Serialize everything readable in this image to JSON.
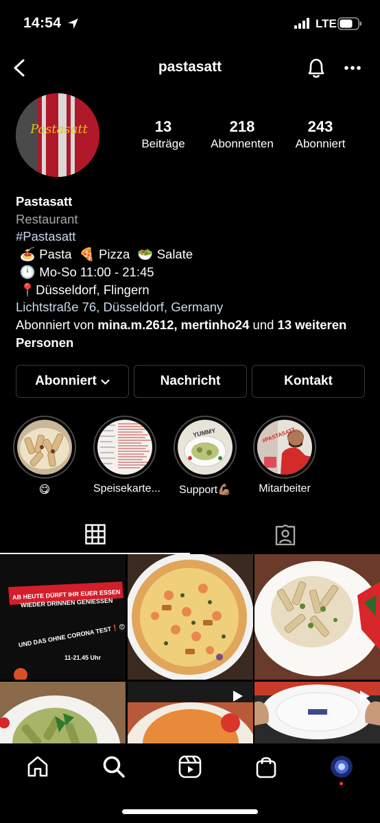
{
  "status_bar": {
    "time": "14:54",
    "network": "LTE"
  },
  "header": {
    "username": "pastasatt"
  },
  "avatar": {
    "logo_text": "Pastasatt"
  },
  "stats": [
    {
      "value": "13",
      "label": "Beiträge"
    },
    {
      "value": "218",
      "label": "Abonnenten"
    },
    {
      "value": "243",
      "label": "Abonniert"
    }
  ],
  "bio": {
    "name": "Pastasatt",
    "category": "Restaurant",
    "hashtag": "#Pastasatt",
    "line1": {
      "e1": "🍝",
      "t1": "Pasta",
      "e2": "🍕",
      "t2": "Pizza",
      "e3": "🥗",
      "t3": "Salate"
    },
    "line2": {
      "e1": "🕛",
      "t1": "Mo-So 11:00 - 21:45"
    },
    "line3": {
      "e1": "📍",
      "t1": "Düsseldorf, Flingern"
    },
    "address": "Lichtstraße 76, Düsseldorf, Germany",
    "followed_by_prefix": "Abonniert von ",
    "followed_by_users": "mina.m.2612, mertinho24",
    "followed_by_and": " und ",
    "followed_by_rest": "13 weiteren Personen"
  },
  "buttons": {
    "follow": "Abonniert",
    "message": "Nachricht",
    "contact": "Kontakt"
  },
  "highlights": [
    {
      "label": "😋"
    },
    {
      "label": "Speisekarte..."
    },
    {
      "label": "Support💪🏽"
    },
    {
      "label": "Mitarbeiter"
    }
  ],
  "posts": {
    "post1": {
      "line1": "AB HEUTE DÜRFT IHR EUER ESSEN",
      "line2": "WIEDER DRINNEN GENIESSEN",
      "line3": "UND DAS OHNE CORONA TEST❗😍",
      "hours": "11-21.45 Uhr"
    },
    "highlight3_text": "YUMMY",
    "highlight4_text": "#PASTASATT"
  },
  "colors": {
    "brand_red": "#b0182a",
    "logo_yellow": "#e2c21a",
    "notification_dot": "#ff3040"
  }
}
